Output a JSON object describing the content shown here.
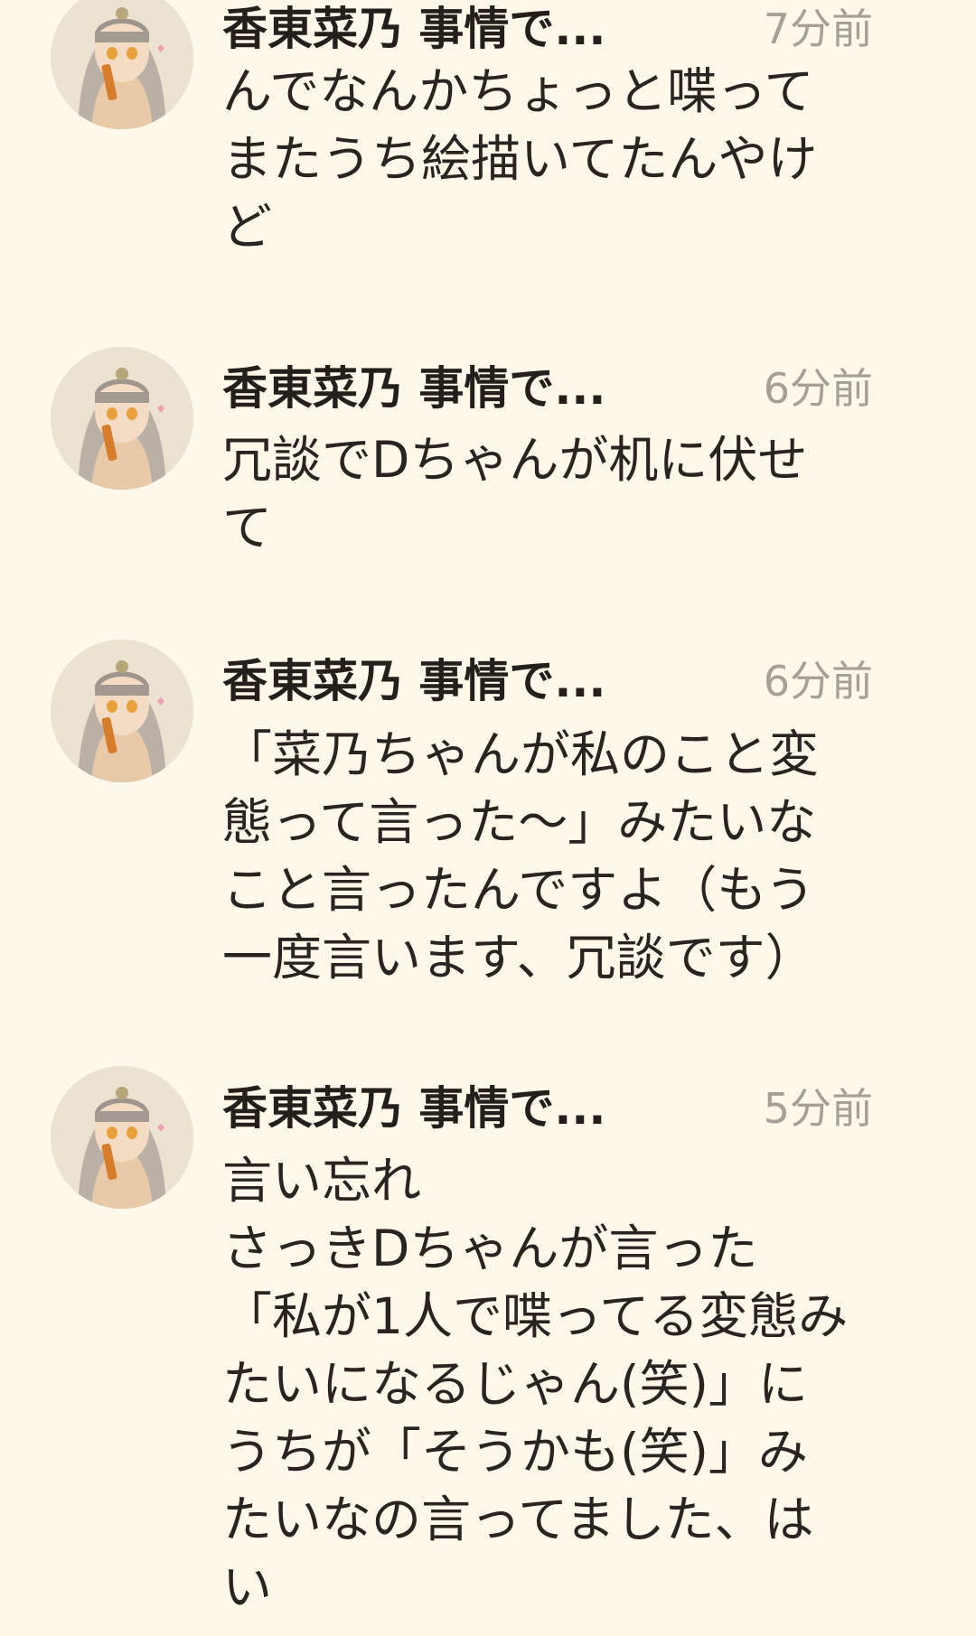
{
  "posts": [
    {
      "author": "香東菜乃 事情で...",
      "time": "7分前",
      "lines": [
        "んでなんかちょっと喋って",
        "またうち絵描いてたんやけ",
        "ど"
      ]
    },
    {
      "author": "香東菜乃 事情で...",
      "time": "6分前",
      "lines": [
        "冗談でDちゃんが机に伏せ",
        "て"
      ]
    },
    {
      "author": "香東菜乃 事情で...",
      "time": "6分前",
      "lines": [
        "「菜乃ちゃんが私のこと変",
        "態って言った〜」みたいな",
        "こと言ったんですよ（もう",
        "一度言います、冗談です）"
      ]
    },
    {
      "author": "香東菜乃 事情で...",
      "time": "5分前",
      "lines": [
        "言い忘れ",
        "さっきDちゃんが言った",
        "「私が1人で喋ってる変態み",
        "たいになるじゃん(笑)」に",
        "うちが「そうかも(笑)」み",
        "たいなの言ってました、は",
        "い"
      ]
    }
  ],
  "icons": {
    "avatar": "user-avatar-illustration-icon"
  },
  "colors": {
    "background": "#fdf8ea",
    "text": "#2a2420",
    "timestamp": "#a59f96"
  }
}
